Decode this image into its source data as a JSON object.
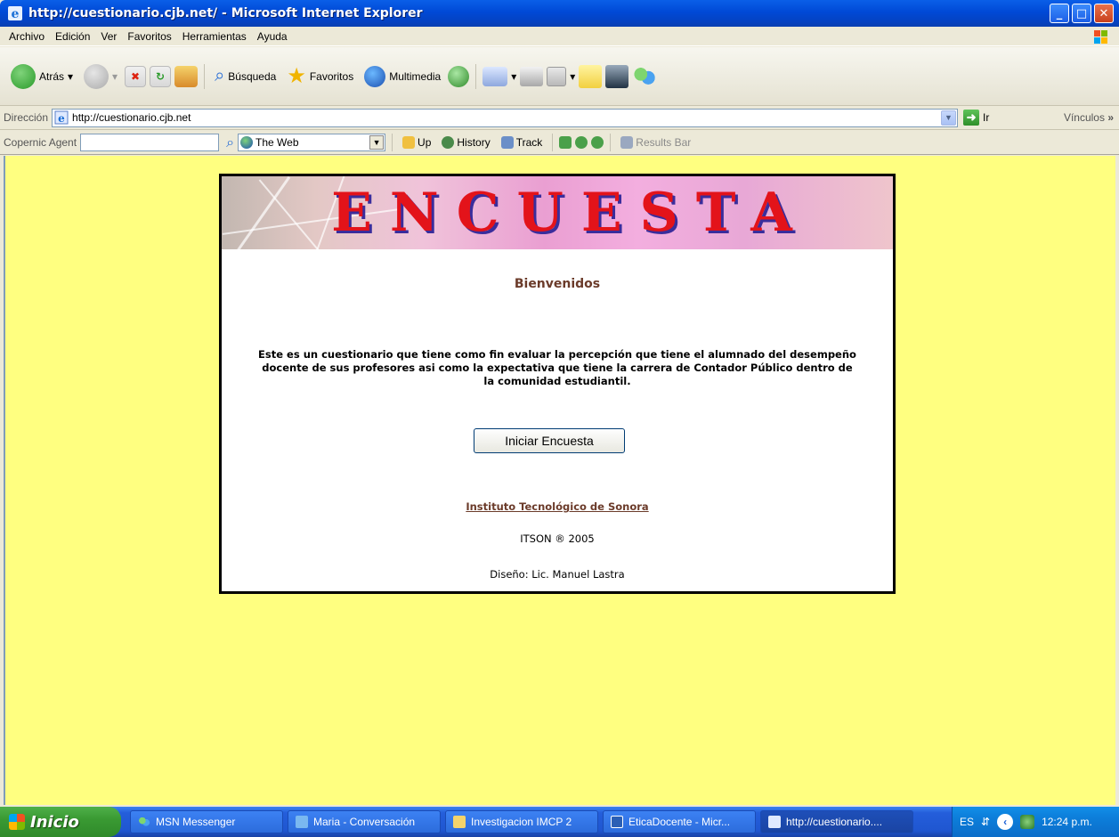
{
  "window": {
    "title": "http://cuestionario.cjb.net/ - Microsoft Internet Explorer"
  },
  "menu": [
    "Archivo",
    "Edición",
    "Ver",
    "Favoritos",
    "Herramientas",
    "Ayuda"
  ],
  "toolbar": {
    "back": "Atrás",
    "search": "Búsqueda",
    "favorites": "Favoritos",
    "media": "Multimedia"
  },
  "address": {
    "label": "Dirección",
    "url": "http://cuestionario.cjb.net",
    "go": "Ir",
    "links": "Vínculos"
  },
  "copernic": {
    "label": "Copernic Agent",
    "scope": "The Web",
    "up": "Up",
    "history": "History",
    "track": "Track",
    "results": "Results Bar"
  },
  "page": {
    "banner_title": "ENCUESTA",
    "welcome": "Bienvenidos",
    "description": "Este es un cuestionario que tiene como fin evaluar la percepción que tiene el alumnado del desempeño docente de sus profesores asi como la expectativa que tiene la carrera de Contador Público dentro de la comunidad estudiantil.",
    "start_button": "Iniciar Encuesta",
    "institute_link": "Instituto Tecnológico de Sonora",
    "copyright": "ITSON ® 2005",
    "credit": "Diseño: Lic. Manuel Lastra",
    "background_color": "#ffff80"
  },
  "taskbar": {
    "start": "Inicio",
    "tasks": [
      "MSN Messenger",
      "Maria - Conversación",
      "Investigacion IMCP 2",
      "EticaDocente - Micr...",
      "http://cuestionario...."
    ],
    "lang": "ES",
    "clock": "12:24 p.m."
  }
}
